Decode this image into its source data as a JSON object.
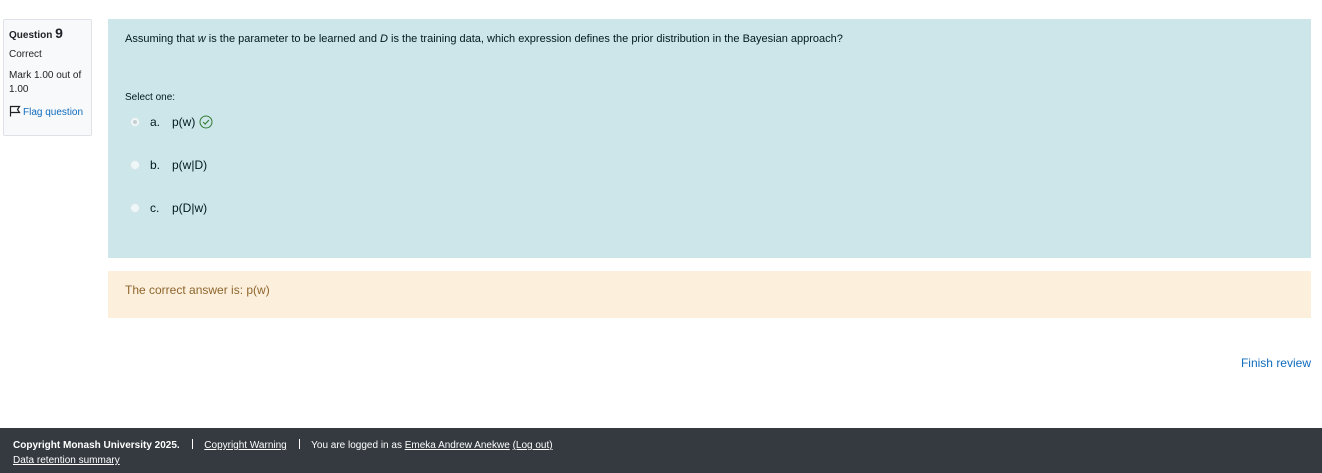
{
  "question_info": {
    "label": "Question",
    "number": "9",
    "state": "Correct",
    "grade": "Mark 1.00 out of 1.00",
    "flag_label": "Flag question",
    "flag_icon": "flag-icon"
  },
  "question": {
    "text_prefix": "Assuming that ",
    "var_w": "w",
    "text_mid": " is the parameter to be learned and ",
    "var_d": "D",
    "text_suffix": " is the training data, which expression defines the prior distribution in the Bayesian approach?",
    "prompt": "Select one:",
    "answers": [
      {
        "letter": "a.",
        "label": "p(w)",
        "selected": true,
        "correct": true
      },
      {
        "letter": "b.",
        "label": "p(w|D)",
        "selected": false,
        "correct": false
      },
      {
        "letter": "c.",
        "label": "p(D|w)",
        "selected": false,
        "correct": false
      }
    ],
    "correct_icon": "check-circle-icon"
  },
  "feedback": {
    "right_answer": "The correct answer is: p(w)"
  },
  "navigation": {
    "finish_review": "Finish review"
  },
  "footer": {
    "copyright": "Copyright Monash University 2025.",
    "copyright_warning": "Copyright Warning",
    "logged_in_prefix": "You are logged in as ",
    "user_name": "Emeka Andrew Anekwe",
    "logout": "(Log out)",
    "data_retention": "Data retention summary"
  },
  "colors": {
    "formulation_bg": "#cce6ea",
    "feedback_bg": "#fcefdc",
    "feedback_text": "#8e662e",
    "link": "#0f6cbf",
    "correct_green": "#357a32",
    "footer_bg": "#343a40"
  }
}
